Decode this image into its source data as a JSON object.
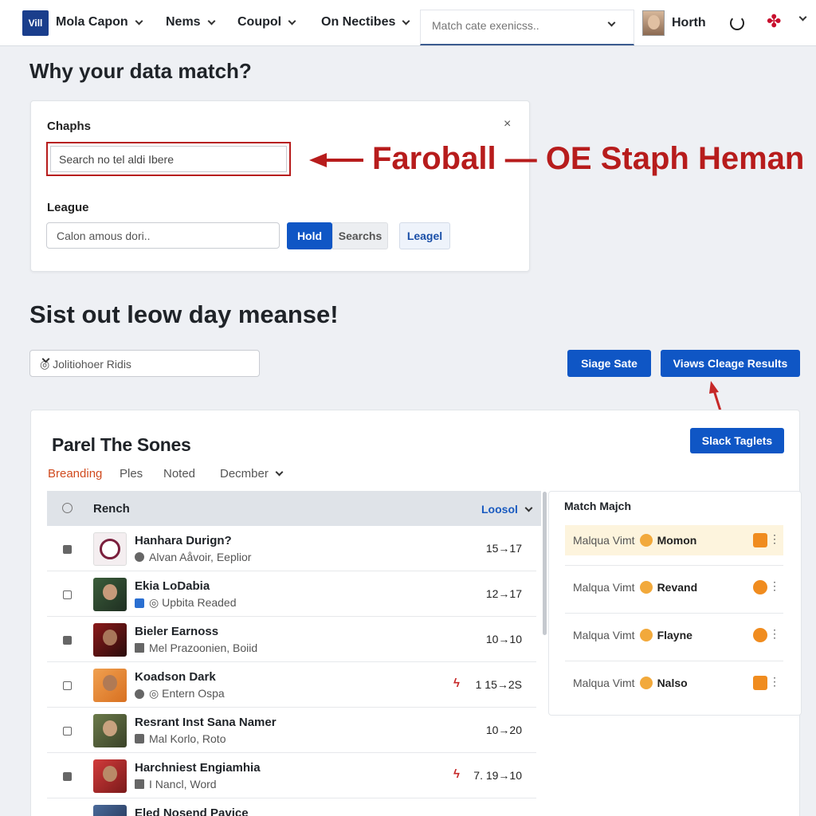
{
  "nav": {
    "logo": "Vill",
    "items": [
      "Mola Capon",
      "Nems",
      "Coupol",
      "On Nectibes"
    ],
    "search_placeholder": "Match cate exenicss..",
    "user_name": "Horth"
  },
  "page": {
    "title": "Why your data match?",
    "section_title": "Sist out leow day meanse!"
  },
  "search_card": {
    "chaphs_label": "Chaphs",
    "search_value": "Search no tel aldi Ibere",
    "close": "×",
    "league_label": "League",
    "league_value": "Calon amous dori..",
    "buttons": {
      "hold": "Hold",
      "searchs": "Searchs",
      "league": "Leagel"
    }
  },
  "annotation": {
    "text": "Faroball — OE Staph Heman",
    "color": "#b71c1c"
  },
  "filter": {
    "select_value": "◎ Jolitiohoer Ridis",
    "stage_button": "Siage Sate",
    "views_button": "Viəws Cleage Results",
    "slack_button": "Slack Taglets"
  },
  "panel": {
    "title": "Parel The Sones",
    "tabs": [
      "Breanding",
      "Ples",
      "Noted",
      "Decmber"
    ],
    "table": {
      "header_name": "Rench",
      "header_sort": "Loosol",
      "rows": [
        {
          "name": "Hanhara Durign?",
          "sub": "Alvan Aåvoir, Eeplior",
          "score": "15→17",
          "flag": "",
          "checked": true
        },
        {
          "name": "Ekia LoDabia",
          "sub": "◎ Upbita Readed",
          "score": "12→17",
          "flag": "",
          "checked": false
        },
        {
          "name": "Bieler Earnoss",
          "sub": "Mel Prazoonien, Boiid",
          "score": "10→10",
          "flag": "",
          "checked": true
        },
        {
          "name": "Koadson Dark",
          "sub": "◎ Entern Ospa",
          "score": "1  15→2S",
          "flag": "ϟ",
          "checked": false
        },
        {
          "name": "Resrant Inst Sana Namer",
          "sub": "Mal Korlo, Roto",
          "score": "10→20",
          "flag": "",
          "checked": false
        },
        {
          "name": "Harchniest Engiamhia",
          "sub": "I Nancl, Word",
          "score": "7. 19→10",
          "flag": "ϟ",
          "checked": true
        },
        {
          "name": "Eled Nosend Pavice",
          "sub": "",
          "score": "",
          "flag": "",
          "checked": false
        }
      ]
    },
    "matches": {
      "title": "Match Majch",
      "items": [
        {
          "label": "Malqua Vimt",
          "name": "Momon"
        },
        {
          "label": "Malqua Vimt",
          "name": "Revand"
        },
        {
          "label": "Malqua Vimt",
          "name": "Flayne"
        },
        {
          "label": "Malqua Vimt",
          "name": "Nalso"
        }
      ]
    }
  },
  "colors": {
    "primary_blue": "#0f56c5",
    "accent_red": "#b71c1c",
    "tab_active": "#d04a1e",
    "highlight": "#fdf4dd"
  }
}
